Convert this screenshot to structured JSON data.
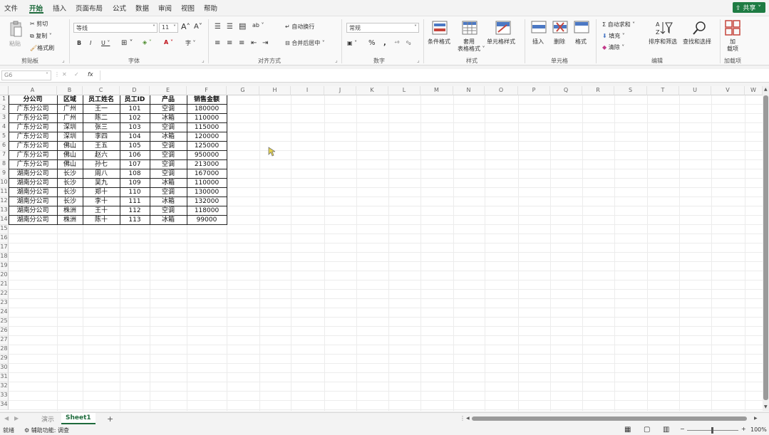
{
  "menu": {
    "items": [
      "文件",
      "开始",
      "插入",
      "页面布局",
      "公式",
      "数据",
      "审阅",
      "视图",
      "帮助"
    ],
    "share": "共享"
  },
  "ribbon": {
    "clipboard": {
      "paste": "粘贴",
      "cut": "剪切",
      "copy": "复制",
      "format_painter": "格式刷",
      "label": "剪贴板"
    },
    "font": {
      "name": "等线",
      "size": "11",
      "label": "字体"
    },
    "alignment": {
      "wrap": "自动换行",
      "merge": "合并后居中",
      "label": "对齐方式"
    },
    "number": {
      "format": "常规",
      "label": "数字"
    },
    "styles": {
      "conditional": "条件格式",
      "table": "套用\n表格格式",
      "cell_styles": "单元格样式",
      "label": "样式"
    },
    "cells": {
      "insert": "插入",
      "delete": "删除",
      "format": "格式",
      "label": "单元格"
    },
    "editing": {
      "autosum": "自动求和",
      "fill": "填充",
      "clear": "清除",
      "sort": "排序和筛选",
      "find": "查找和选择",
      "label": "编辑"
    },
    "addins": {
      "label": "加载项",
      "btn": "加\n载项"
    }
  },
  "formula_bar": {
    "namebox": "G6",
    "fx": "fx"
  },
  "columns": [
    "A",
    "B",
    "C",
    "D",
    "E",
    "F",
    "G",
    "H",
    "I",
    "J",
    "K",
    "L",
    "M",
    "N",
    "O",
    "P",
    "Q",
    "R",
    "S",
    "T",
    "U",
    "V",
    "W"
  ],
  "table": {
    "headers": [
      "分公司",
      "区域",
      "员工姓名",
      "员工ID",
      "产品",
      "销售金额"
    ],
    "rows": [
      [
        "广东分公司",
        "广州",
        "王一",
        "101",
        "空调",
        "180000"
      ],
      [
        "广东分公司",
        "广州",
        "陈二",
        "102",
        "冰箱",
        "110000"
      ],
      [
        "广东分公司",
        "深圳",
        "张三",
        "103",
        "空调",
        "115000"
      ],
      [
        "广东分公司",
        "深圳",
        "李四",
        "104",
        "冰箱",
        "120000"
      ],
      [
        "广东分公司",
        "佛山",
        "王五",
        "105",
        "空调",
        "125000"
      ],
      [
        "广东分公司",
        "佛山",
        "赵六",
        "106",
        "空调",
        "950000"
      ],
      [
        "广东分公司",
        "佛山",
        "孙七",
        "107",
        "空调",
        "213000"
      ],
      [
        "湖南分公司",
        "长沙",
        "周八",
        "108",
        "空调",
        "167000"
      ],
      [
        "湖南分公司",
        "长沙",
        "吴九",
        "109",
        "冰箱",
        "110000"
      ],
      [
        "湖南分公司",
        "长沙",
        "郑十",
        "110",
        "空调",
        "130000"
      ],
      [
        "湖南分公司",
        "长沙",
        "李十",
        "111",
        "冰箱",
        "132000"
      ],
      [
        "湖南分公司",
        "株洲",
        "王十",
        "112",
        "空调",
        "118000"
      ],
      [
        "湖南分公司",
        "株洲",
        "陈十",
        "113",
        "冰箱",
        "99000"
      ]
    ]
  },
  "row_numbers": [
    "1",
    "2",
    "3",
    "4",
    "5",
    "6",
    "7",
    "8",
    "9",
    "10",
    "11",
    "12",
    "13",
    "14",
    "15",
    "16",
    "17",
    "18",
    "19",
    "20",
    "21",
    "22",
    "23",
    "24",
    "25",
    "26",
    "27",
    "28",
    "29",
    "30",
    "31",
    "32",
    "33",
    "34"
  ],
  "sheets": {
    "tabs": [
      "演示",
      "Sheet1"
    ],
    "active": "Sheet1",
    "add": "+"
  },
  "status": {
    "ready": "就绪",
    "accessibility": "辅助功能: 调查",
    "zoom": "100%"
  },
  "colors": {
    "accent": "#1e6b3c",
    "share": "#1e7b43"
  }
}
